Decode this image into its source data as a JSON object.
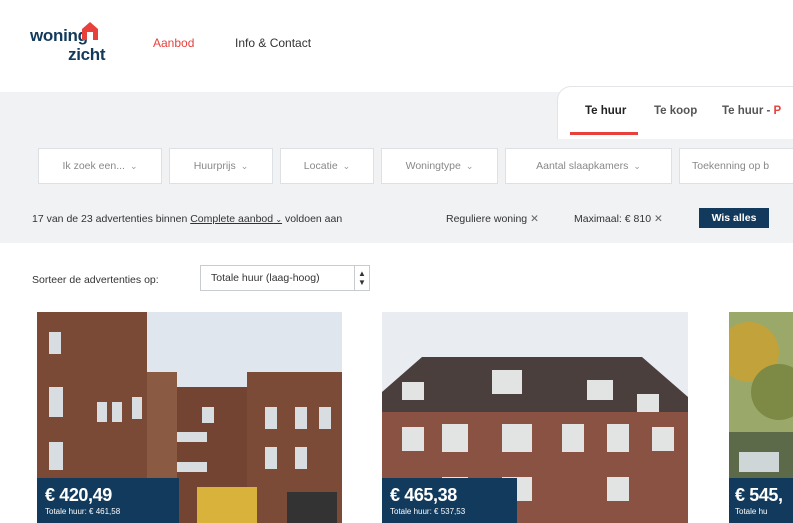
{
  "header": {
    "logo_line1": "woning",
    "logo_line2": "zicht",
    "nav": [
      {
        "label": "Aanbod",
        "active": true
      },
      {
        "label": "Info & Contact",
        "active": false
      }
    ]
  },
  "tabs": [
    {
      "label": "Te huur",
      "active": true
    },
    {
      "label": "Te koop",
      "active": false
    },
    {
      "label": "Te huur - ",
      "suffix": "P",
      "active": false
    }
  ],
  "filters": [
    {
      "label": "Ik zoek een..."
    },
    {
      "label": "Huurprijs"
    },
    {
      "label": "Locatie"
    },
    {
      "label": "Woningtype"
    },
    {
      "label": "Aantal slaapkamers"
    },
    {
      "label": "Toekenning op b"
    }
  ],
  "summary": {
    "prefix": "17 van de 23 advertenties binnen ",
    "link": "Complete aanbod",
    "suffix": " voldoen aan",
    "chips": [
      "Reguliere woning",
      "Maximaal: € 810"
    ],
    "clear_label": "Wis alles"
  },
  "sort": {
    "label": "Sorteer de advertenties op:",
    "selected": "Totale huur (laag-hoog)"
  },
  "listings": [
    {
      "price": "€ 420,49",
      "total": "Totale huur: € 461,58"
    },
    {
      "price": "€ 465,38",
      "total": "Totale huur: € 537,53"
    },
    {
      "price": "€ 545,",
      "total": "Totale hu"
    }
  ],
  "colors": {
    "brand_navy": "#123a5c",
    "accent_red": "#e8413b",
    "filter_bg": "#f1f2f4"
  }
}
